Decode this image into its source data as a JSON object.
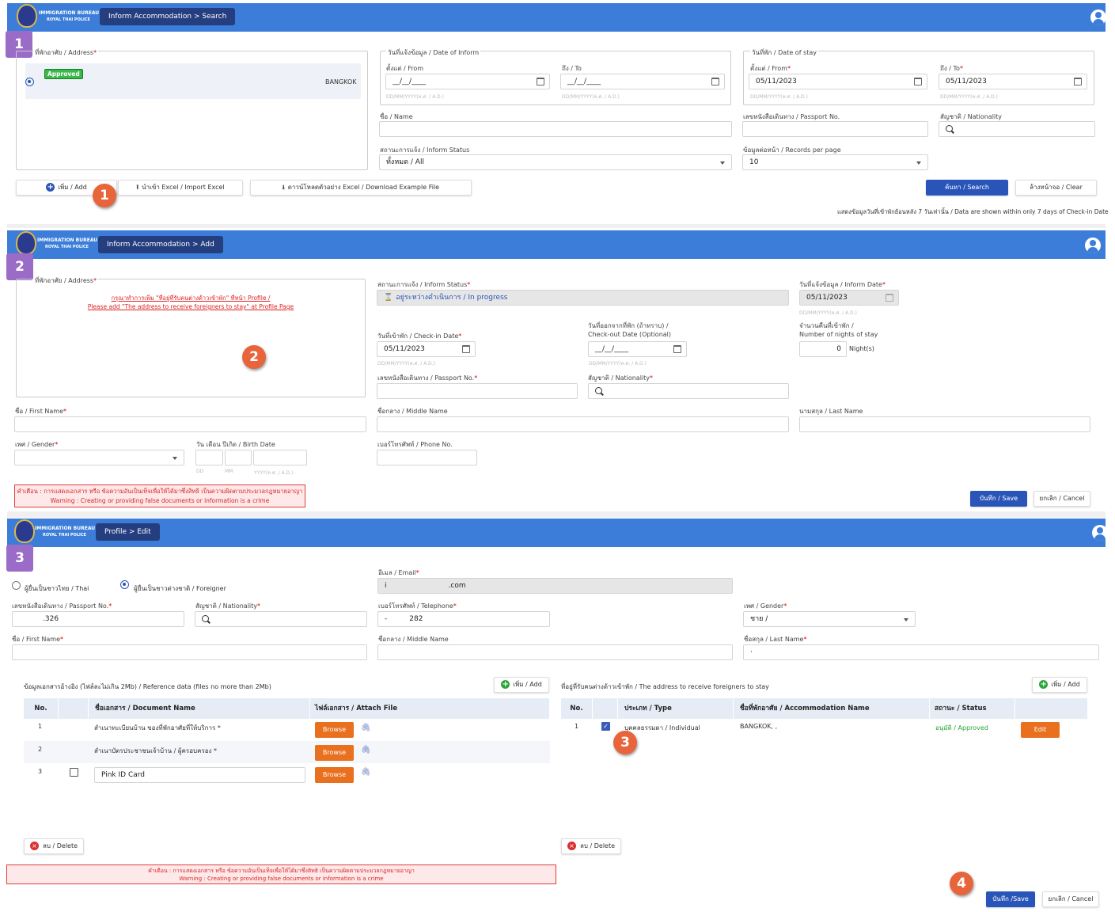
{
  "header": {
    "logo_line1": "IMMIGRATION BUREAU",
    "logo_line2": "ROYAL THAI POLICE"
  },
  "panel1": {
    "breadcrumb": "Inform Accommodation > Search",
    "marker": "1",
    "address_legend": "ที่พักอาศัย / Address",
    "approved_badge": "Approved",
    "address_city": "BANGKOK",
    "inform_date_legend": "วันที่แจ้งข้อมูล / Date of Inform",
    "from_label": "ตั้งแต่ / From",
    "to_label": "ถึง / To",
    "date_placeholder": "__/__/____",
    "date_hint": "DD/MM/YYYY(ค.ศ. / A.D.)",
    "stay_legend": "วันที่พัก / Date of stay",
    "stay_from": "05/11/2023",
    "stay_to": "05/11/2023",
    "name_label": "ชื่อ / Name",
    "passport_label": "เลขหนังสือเดินทาง / Passport No.",
    "nationality_label": "สัญชาติ / Nationality",
    "status_label": "สถานะการแจ้ง / Inform Status",
    "status_value": "ทั้งหมด / All",
    "records_label": "ข้อมูลต่อหน้า / Records per page",
    "records_value": "10",
    "add_btn": "เพิ่ม / Add",
    "import_btn": "นำเข้า Excel / Import Excel",
    "download_btn": "ดาวน์โหลดตัวอย่าง Excel / Download Example File",
    "search_btn": "ค้นหา / Search",
    "clear_btn": "ล้างหน้าจอ / Clear",
    "footnote": "แสดงข้อมูลวันที่เข้าพักย้อนหลัง 7 วันเท่านั้น / Data are shown within only 7 days of Check-in Date",
    "callout": "1"
  },
  "panel2": {
    "breadcrumb": "Inform Accommodation > Add",
    "marker": "2",
    "address_legend": "ที่พักอาศัย / Address",
    "address_msg1": "กรุณาทำการเพิ่ม \"ที่อยู่ที่รับคนต่างด้าวเข้าพัก\" ที่หน้า Profile /",
    "address_msg2": "Please add \"The address to receive foreigners to stay\" at Profile Page",
    "callout": "2",
    "status_label": "สถานะการแจ้ง / Inform Status",
    "status_value": "อยู่ระหว่างดำเนินการ / In progress",
    "inform_date_label": "วันที่แจ้งข้อมูล / Inform Date",
    "inform_date_value": "05/11/2023",
    "date_hint": "DD/MM/YYYY(ค.ศ. / A.D.)",
    "checkin_label": "วันที่เข้าพัก / Check-in Date",
    "checkin_value": "05/11/2023",
    "checkout_label1": "วันที่ออกจากที่พัก (ถ้าทราบ) /",
    "checkout_label2": "Check-out Date (Optional)",
    "checkout_value": "__/__/____",
    "nights_label1": "จำนวนคืนที่เข้าพัก /",
    "nights_label2": "Number of nights of stay",
    "nights_value": "0",
    "nights_unit": "Night(s)",
    "passport_label": "เลขหนังสือเดินทาง / Passport No.",
    "nationality_label": "สัญชาติ / Nationality",
    "first_label": "ชื่อ / First Name",
    "middle_label": "ชื่อกลาง / Middle Name",
    "last_label": "นามสกุล / Last Name",
    "gender_label": "เพศ / Gender",
    "birth_label": "วัน เดือน ปีเกิด / Birth Date",
    "dd": "DD",
    "mm": "MM",
    "yyyy": "YYYY(ค.ศ. / A.D.)",
    "phone_label": "เบอร์โทรศัพท์ / Phone No.",
    "warn1": "คำเตือน : การแสดงเอกสาร หรือ ข้อความอันเป็นเท็จเพื่อให้ได้มาซึ่งสิทธิ เป็นความผิดตามประมวลกฎหมายอาญา",
    "warn2": "Warning : Creating or providing false documents or information is a crime",
    "save_btn": "บันทึก / Save",
    "cancel_btn": "ยกเลิก / Cancel"
  },
  "panel3": {
    "breadcrumb": "Profile > Edit",
    "marker": "3",
    "radio_thai": "ผู้ยื่นเป็นชาวไทย / Thai",
    "radio_foreign": "ผู้ยื่นเป็นชาวต่างชาติ / Foreigner",
    "email_label": "อีเมล / Email",
    "email_prefix": "i",
    "email_suffix": ".com",
    "passport_label": "เลขหนังสือเดินทาง / Passport No.",
    "passport_value": ".326",
    "nationality_label": "สัญชาติ / Nationality",
    "tel_label": "เบอร์โทรศัพท์ / Telephone",
    "tel_prefix": "-",
    "tel_value": "282",
    "gender_label": "เพศ / Gender",
    "gender_value": "ชาย /",
    "first_label": "ชื่อ / First Name",
    "middle_label": "ชื่อกลาง / Middle Name",
    "last_label": "ชื่อสกุล / Last Name",
    "last_value": "·",
    "ref_title": "ข้อมูลเอกสารอ้างอิง (ไฟล์ละไม่เกิน 2Mb) / Reference data (files no more than 2Mb)",
    "add_btn": "เพิ่ม / Add",
    "doc_cols": [
      "No.",
      "",
      "ชื่อเอกสาร / Document Name",
      "ไฟล์เอกสาร / Attach File"
    ],
    "docs": [
      {
        "no": "1",
        "name": "สำเนาทะเบียนบ้าน ของที่พักอาศัยที่ให้บริการ *",
        "browse": "Browse"
      },
      {
        "no": "2",
        "name": "สำเนาบัตรประชาชนเจ้าบ้าน / ผู้ครอบครอง *",
        "browse": "Browse"
      },
      {
        "no": "3",
        "name": "Pink ID Card",
        "browse": "Browse"
      }
    ],
    "addr_title": "ที่อยู่ที่รับคนต่างด้าวเข้าพัก / The address to receive foreigners to stay",
    "addr_cols": [
      "No.",
      "",
      "ประเภท / Type",
      "ชื่อที่พักอาศัย / Accommodation Name",
      "สถานะ / Status",
      ""
    ],
    "addr_row": {
      "no": "1",
      "type": "บุคคลธรรมดา / Individual",
      "name": "BANGKOK, ,",
      "status": "อนุมัติ / Approved",
      "edit": "Edit"
    },
    "callout3": "3",
    "delete_btn": "ลบ / Delete",
    "warn1": "คำเตือน : การแสดงเอกสาร หรือ ข้อความอันเป็นเท็จเพื่อให้ได้มาซึ่งสิทธิ เป็นความผิดตามประมวลกฎหมายอาญา",
    "warn2": "Warning : Creating or providing false documents or information is a crime",
    "callout4": "4",
    "save_btn": "บันทึก /Save",
    "cancel_btn": "ยกเลิก / Cancel"
  },
  "colors": {
    "header": "#3b7dd8",
    "crumb": "#243e7f",
    "marker": "#9b6bc8",
    "callout": "#e8643b",
    "primary": "#2a55b8",
    "browse": "#e8701e"
  }
}
